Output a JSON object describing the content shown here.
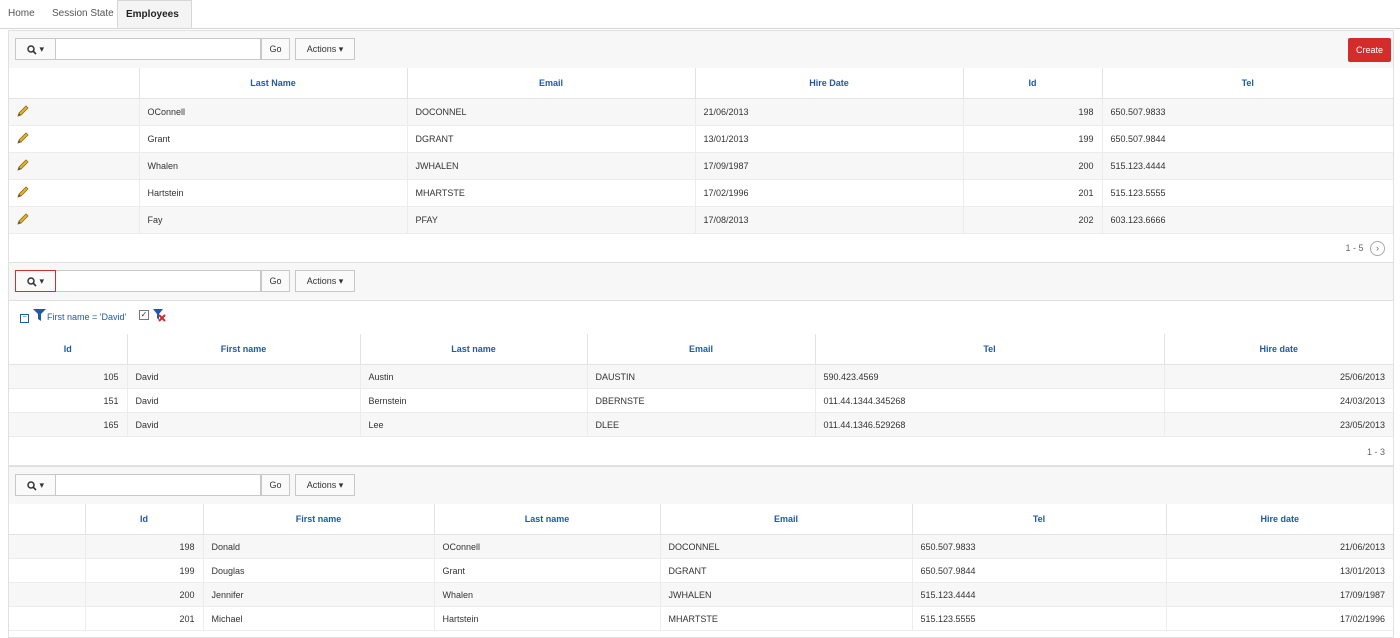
{
  "tabs": [
    {
      "label": "Home"
    },
    {
      "label": "Session State"
    },
    {
      "label": "Employees"
    }
  ],
  "toolbar": {
    "go_label": "Go",
    "actions_label": "Actions ▾",
    "create_label": "Create",
    "search_icon": "magnifier-icon"
  },
  "report1": {
    "columns": [
      "Last Name",
      "Email",
      "Hire Date",
      "Id",
      "Tel"
    ],
    "rows": [
      {
        "last": "OConnell",
        "email": "DOCONNEL",
        "hire": "21/06/2013",
        "id": "198",
        "tel": "650.507.9833"
      },
      {
        "last": "Grant",
        "email": "DGRANT",
        "hire": "13/01/2013",
        "id": "199",
        "tel": "650.507.9844"
      },
      {
        "last": "Whalen",
        "email": "JWHALEN",
        "hire": "17/09/1987",
        "id": "200",
        "tel": "515.123.4444"
      },
      {
        "last": "Hartstein",
        "email": "MHARTSTE",
        "hire": "17/02/1996",
        "id": "201",
        "tel": "515.123.5555"
      },
      {
        "last": "Fay",
        "email": "PFAY",
        "hire": "17/08/2013",
        "id": "202",
        "tel": "603.123.6666"
      }
    ],
    "pagination": "1 - 5"
  },
  "report2": {
    "filter_label": "First name = 'David'",
    "columns": [
      "Id",
      "First name",
      "Last name",
      "Email",
      "Tel",
      "Hire date"
    ],
    "rows": [
      {
        "id": "105",
        "first": "David",
        "last": "Austin",
        "email": "DAUSTIN",
        "tel": "590.423.4569",
        "hire": "25/06/2013"
      },
      {
        "id": "151",
        "first": "David",
        "last": "Bernstein",
        "email": "DBERNSTE",
        "tel": "011.44.1344.345268",
        "hire": "24/03/2013"
      },
      {
        "id": "165",
        "first": "David",
        "last": "Lee",
        "email": "DLEE",
        "tel": "011.44.1346.529268",
        "hire": "23/05/2013"
      }
    ],
    "pagination": "1 - 3"
  },
  "report3": {
    "columns": [
      "Id",
      "First name",
      "Last name",
      "Email",
      "Tel",
      "Hire date"
    ],
    "rows": [
      {
        "id": "198",
        "first": "Donald",
        "last": "OConnell",
        "email": "DOCONNEL",
        "tel": "650.507.9833",
        "hire": "21/06/2013"
      },
      {
        "id": "199",
        "first": "Douglas",
        "last": "Grant",
        "email": "DGRANT",
        "tel": "650.507.9844",
        "hire": "13/01/2013"
      },
      {
        "id": "200",
        "first": "Jennifer",
        "last": "Whalen",
        "email": "JWHALEN",
        "tel": "515.123.4444",
        "hire": "17/09/1987"
      },
      {
        "id": "201",
        "first": "Michael",
        "last": "Hartstein",
        "email": "MHARTSTE",
        "tel": "515.123.5555",
        "hire": "17/02/1996"
      }
    ]
  },
  "colors": {
    "accent": "#1e5aa8",
    "create": "#d42b2b",
    "focus": "#d32f2f"
  }
}
